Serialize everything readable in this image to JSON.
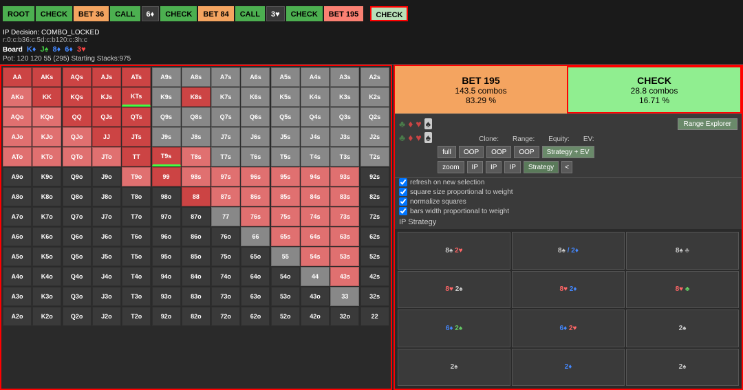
{
  "nav": {
    "row1": [
      {
        "label": "ROOT",
        "style": "green"
      },
      {
        "label": "CHECK",
        "style": "green"
      },
      {
        "label": "BET 36",
        "style": "orange"
      },
      {
        "label": "CALL",
        "style": "green"
      },
      {
        "label": "6♦",
        "style": "default"
      },
      {
        "label": "CHECK",
        "style": "green"
      },
      {
        "label": "BET 84",
        "style": "orange"
      },
      {
        "label": "CALL",
        "style": "green"
      },
      {
        "label": "3♥",
        "style": "default"
      },
      {
        "label": "CHECK",
        "style": "green"
      },
      {
        "label": "BET 195",
        "style": "salmon"
      }
    ],
    "row2": [
      {
        "label": "CHECK",
        "style": "green"
      }
    ]
  },
  "info": {
    "ip_decision": "IP Decision: COMBO_LOCKED",
    "hand_history": "r:0:c:b36:c:5d:c:b120:c:3h:c",
    "board_label": "Board",
    "cards": [
      "K♦",
      "J♠",
      "8♦",
      "6♦",
      "3♥"
    ],
    "pot_info": "Pot: 120 120 55 (295) Starting Stacks:975"
  },
  "actions": {
    "bet": {
      "label": "BET 195",
      "combos": "143.5 combos",
      "pct": "83.29 %"
    },
    "check": {
      "label": "CHECK",
      "combos": "28.8 combos",
      "pct": "16.71 %"
    }
  },
  "controls": {
    "clone_label": "Clone:",
    "range_label": "Range:",
    "equity_label": "Equity:",
    "ev_label": "EV:",
    "range_explorer": "Range Explorer",
    "full_btn": "full",
    "zoom_btn": "zoom",
    "oop_btn": "OOP",
    "ip_btn": "IP",
    "strategy_btn": "Strategy",
    "strategy_ev_btn": "Strategy + EV",
    "arrow_btn": "<"
  },
  "checkboxes": [
    {
      "label": "refresh on new selection",
      "checked": true
    },
    {
      "label": "square size proportional to weight",
      "checked": true
    },
    {
      "label": "normalize squares",
      "checked": true
    },
    {
      "label": "bars width proportional to weight",
      "checked": true
    }
  ],
  "ip_strategy_label": "IP Strategy",
  "combo_cells": [
    {
      "hand": "8♠ 2♥",
      "col": "black"
    },
    {
      "hand": "8♠ / 2♦",
      "col": "blue"
    },
    {
      "hand": "8♠ ♣",
      "col": "black"
    },
    {
      "hand": "8♥ 2♠",
      "col": "black"
    },
    {
      "hand": "8♥ 2♦",
      "col": "blue"
    },
    {
      "hand": "8♥ ♣",
      "col": "red"
    },
    {
      "hand": "6♦ 2♠",
      "col": "green"
    },
    {
      "hand": "6♦ 2♥",
      "col": "red"
    },
    {
      "hand": "2♠",
      "col": "black"
    },
    {
      "hand": "2♠",
      "col": "black"
    },
    {
      "hand": "2♦",
      "col": "blue"
    },
    {
      "hand": "2♠",
      "col": "black"
    }
  ],
  "grid_rows": [
    [
      "AA",
      "AKs",
      "AQs",
      "AJs",
      "ATs",
      "A9s",
      "A8s",
      "A7s",
      "A6s",
      "A5s",
      "A4s",
      "A3s",
      "A2s"
    ],
    [
      "AKo",
      "KK",
      "KQs",
      "KJs",
      "KTs",
      "K9s",
      "K8s",
      "K7s",
      "K6s",
      "K5s",
      "K4s",
      "K3s",
      "K2s"
    ],
    [
      "AQo",
      "KQo",
      "QQ",
      "QJs",
      "QTs",
      "Q9s",
      "Q8s",
      "Q7s",
      "Q6s",
      "Q5s",
      "Q4s",
      "Q3s",
      "Q2s"
    ],
    [
      "AJo",
      "KJo",
      "QJo",
      "JJ",
      "JTs",
      "J9s",
      "J8s",
      "J7s",
      "J6s",
      "J5s",
      "J4s",
      "J3s",
      "J2s"
    ],
    [
      "ATo",
      "KTo",
      "QTo",
      "JTo",
      "TT",
      "T9s",
      "T8s",
      "T7s",
      "T6s",
      "T5s",
      "T4s",
      "T3s",
      "T2s"
    ],
    [
      "A9o",
      "K9o",
      "Q9o",
      "J9o",
      "T9o",
      "99",
      "98s",
      "97s",
      "96s",
      "95s",
      "94s",
      "93s",
      "92s"
    ],
    [
      "A8o",
      "K8o",
      "Q8o",
      "J8o",
      "T8o",
      "98o",
      "88",
      "87s",
      "86s",
      "85s",
      "84s",
      "83s",
      "82s"
    ],
    [
      "A7o",
      "K7o",
      "Q7o",
      "J7o",
      "T7o",
      "97o",
      "87o",
      "77",
      "76s",
      "75s",
      "74s",
      "73s",
      "72s"
    ],
    [
      "A6o",
      "K6o",
      "Q6o",
      "J6o",
      "T6o",
      "96o",
      "86o",
      "76o",
      "66",
      "65s",
      "64s",
      "63s",
      "62s"
    ],
    [
      "A5o",
      "K5o",
      "Q5o",
      "J5o",
      "T5o",
      "95o",
      "85o",
      "75o",
      "65o",
      "55",
      "54s",
      "53s",
      "52s"
    ],
    [
      "A4o",
      "K4o",
      "Q4o",
      "J4o",
      "T4o",
      "94o",
      "84o",
      "74o",
      "64o",
      "54o",
      "44",
      "43s",
      "42s"
    ],
    [
      "A3o",
      "K3o",
      "Q3o",
      "J3o",
      "T3o",
      "93o",
      "83o",
      "73o",
      "63o",
      "53o",
      "43o",
      "33",
      "32s"
    ],
    [
      "A2o",
      "K2o",
      "Q2o",
      "J2o",
      "T2o",
      "92o",
      "82o",
      "72o",
      "62o",
      "52o",
      "42o",
      "32o",
      "22"
    ]
  ],
  "grid_colors": [
    [
      "red",
      "red",
      "red",
      "red",
      "red",
      "gray",
      "gray",
      "gray",
      "gray",
      "gray",
      "gray",
      "gray",
      "gray"
    ],
    [
      "salmon",
      "red",
      "red",
      "red",
      "red",
      "gray",
      "red",
      "gray",
      "gray",
      "gray",
      "gray",
      "gray",
      "gray"
    ],
    [
      "salmon",
      "salmon",
      "red",
      "red",
      "red",
      "gray",
      "gray",
      "gray",
      "gray",
      "gray",
      "gray",
      "gray",
      "gray"
    ],
    [
      "salmon",
      "salmon",
      "salmon",
      "red",
      "red",
      "gray",
      "gray",
      "gray",
      "gray",
      "gray",
      "gray",
      "gray",
      "gray"
    ],
    [
      "salmon",
      "salmon",
      "salmon",
      "salmon",
      "red",
      "red",
      "salmon",
      "gray",
      "gray",
      "gray",
      "gray",
      "gray",
      "gray"
    ],
    [
      "dark",
      "dark",
      "dark",
      "dark",
      "salmon",
      "red",
      "salmon",
      "salmon",
      "salmon",
      "salmon",
      "salmon",
      "salmon",
      "dark"
    ],
    [
      "dark",
      "dark",
      "dark",
      "dark",
      "dark",
      "dark",
      "red",
      "salmon",
      "salmon",
      "salmon",
      "salmon",
      "salmon",
      "dark"
    ],
    [
      "dark",
      "dark",
      "dark",
      "dark",
      "dark",
      "dark",
      "dark",
      "gray",
      "salmon",
      "salmon",
      "salmon",
      "salmon",
      "dark"
    ],
    [
      "dark",
      "dark",
      "dark",
      "dark",
      "dark",
      "dark",
      "dark",
      "dark",
      "gray",
      "salmon",
      "salmon",
      "salmon",
      "dark"
    ],
    [
      "dark",
      "dark",
      "dark",
      "dark",
      "dark",
      "dark",
      "dark",
      "dark",
      "dark",
      "gray",
      "salmon",
      "salmon",
      "dark"
    ],
    [
      "dark",
      "dark",
      "dark",
      "dark",
      "dark",
      "dark",
      "dark",
      "dark",
      "dark",
      "dark",
      "gray",
      "salmon",
      "dark"
    ],
    [
      "dark",
      "dark",
      "dark",
      "dark",
      "dark",
      "dark",
      "dark",
      "dark",
      "dark",
      "dark",
      "dark",
      "gray",
      "dark"
    ],
    [
      "dark",
      "dark",
      "dark",
      "dark",
      "dark",
      "dark",
      "dark",
      "dark",
      "dark",
      "dark",
      "dark",
      "dark",
      "dark"
    ]
  ]
}
